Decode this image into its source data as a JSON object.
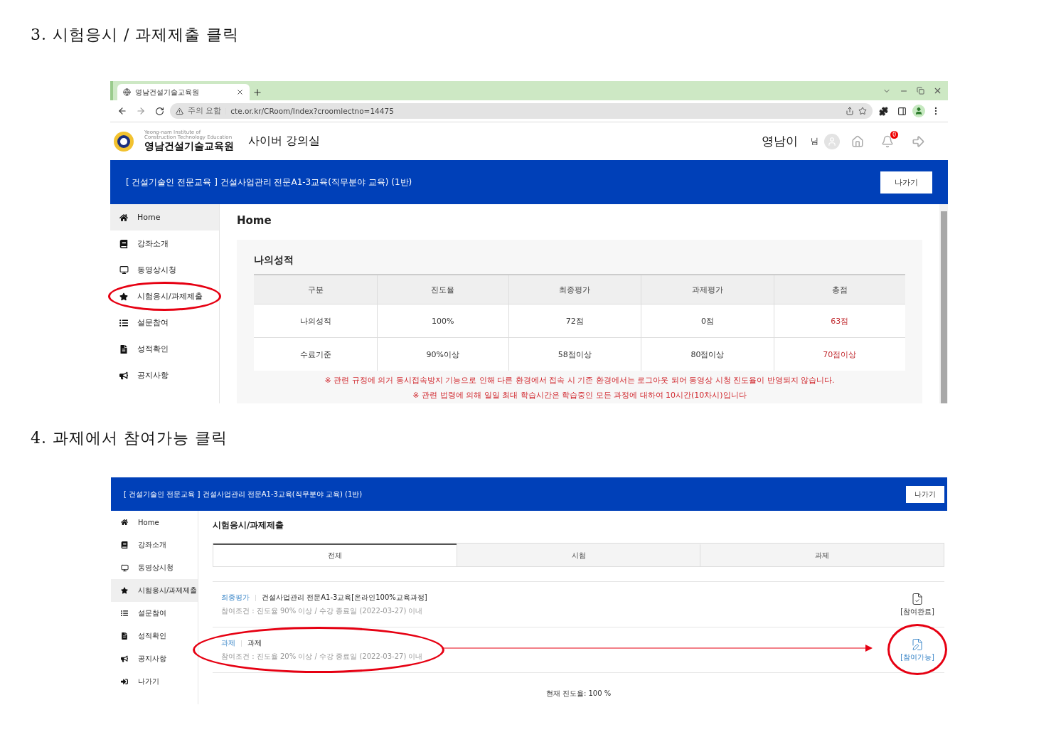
{
  "step3": {
    "heading": "3. 시험응시 / 과제제출 클릭",
    "browser": {
      "tab_title": "영남건설기술교육원",
      "url_warning": "주의 요함",
      "url": "cte.or.kr/CRoom/Index?croomlectno=14475"
    },
    "site": {
      "logo_english": [
        "Yeong-nam Institute of",
        "Construction Technology Education"
      ],
      "logo_name": "영남건설기술교육원",
      "section": "사이버 강의실",
      "user_name": "영남이",
      "user_suffix": "님",
      "notification_count": "0"
    },
    "course_bar": {
      "title": "[ 건설기술인 전문교육 ] 건설사업관리 전문A1-3교육(직무분야 교육) (1반)",
      "exit_button": "나가기"
    },
    "sidebar": [
      {
        "label": "Home",
        "kind": "home",
        "selected": true,
        "circled": false
      },
      {
        "label": "강좌소개",
        "kind": "notebook",
        "selected": false,
        "circled": false
      },
      {
        "label": "동영상시청",
        "kind": "monitor",
        "selected": false,
        "circled": false
      },
      {
        "label": "시험응시/과제제출",
        "kind": "star",
        "selected": false,
        "circled": true
      },
      {
        "label": "설문참여",
        "kind": "list",
        "selected": false,
        "circled": false
      },
      {
        "label": "성적확인",
        "kind": "report",
        "selected": false,
        "circled": false
      },
      {
        "label": "공지사항",
        "kind": "megaphone",
        "selected": false,
        "circled": false
      }
    ],
    "page_title": "Home",
    "grades": {
      "title": "나의성적",
      "columns": [
        {
          "label": "구분",
          "emphasis": false
        },
        {
          "label": "진도율",
          "emphasis": false
        },
        {
          "label": "최종평가",
          "emphasis": false
        },
        {
          "label": "과제평가",
          "emphasis": false
        },
        {
          "label": "총점",
          "emphasis": true
        }
      ],
      "rows": [
        [
          "나의성적",
          "100%",
          "72점",
          "0점",
          "63점"
        ],
        [
          "수료기준",
          "90%이상",
          "58점이상",
          "80점이상",
          "70점이상"
        ]
      ]
    },
    "notices": [
      "※ 관련 규정에 의거 동시접속방지 기능으로 인해 다른 환경에서 접속 시 기존 환경에서는 로그아웃 되어 동영상 시청 진도율이 반영되지 않습니다.",
      "※ 관련 법령에 의해 일일 최대 학습시간은 학습중인 모든 과정에 대하여 10시간(10차시)입니다"
    ]
  },
  "step4": {
    "heading": "4. 과제에서 참여가능 클릭",
    "course_bar": {
      "title": "[ 건설기술인 전문교육 ] 건설사업관리 전문A1-3교육(직무분야 교육) (1반)",
      "exit_button": "나가기"
    },
    "sidebar": [
      {
        "label": "Home",
        "kind": "home",
        "selected": false
      },
      {
        "label": "강좌소개",
        "kind": "notebook",
        "selected": false
      },
      {
        "label": "동영상시청",
        "kind": "monitor",
        "selected": false
      },
      {
        "label": "시험응시/과제제출",
        "kind": "star",
        "selected": true
      },
      {
        "label": "설문참여",
        "kind": "list",
        "selected": false
      },
      {
        "label": "성적확인",
        "kind": "report",
        "selected": false
      },
      {
        "label": "공지사항",
        "kind": "megaphone",
        "selected": false
      },
      {
        "label": "나가기",
        "kind": "exit",
        "selected": false
      }
    ],
    "page_title": "시험응시/과제제출",
    "tabs": [
      {
        "label": "전체",
        "selected": true
      },
      {
        "label": "시험",
        "selected": false
      },
      {
        "label": "과제",
        "selected": false
      }
    ],
    "items": [
      {
        "category": "최종평가",
        "title": "건설사업관리 전문A1-3교육[온라인100%교육과정]",
        "condition": "참여조건 : 진도율 90% 이상 / 수강 종료일 (2022-03-27) 이내",
        "status": "[참여완료]",
        "kind": "done",
        "circled": false
      },
      {
        "category": "과제",
        "title": "과제",
        "condition": "참여조건 : 진도율 20% 이상 / 수강 종료일 (2022-03-27) 이내",
        "status": "[참여가능]",
        "kind": "available",
        "circled": true
      }
    ],
    "progress": "현재 진도율: 100 %"
  }
}
